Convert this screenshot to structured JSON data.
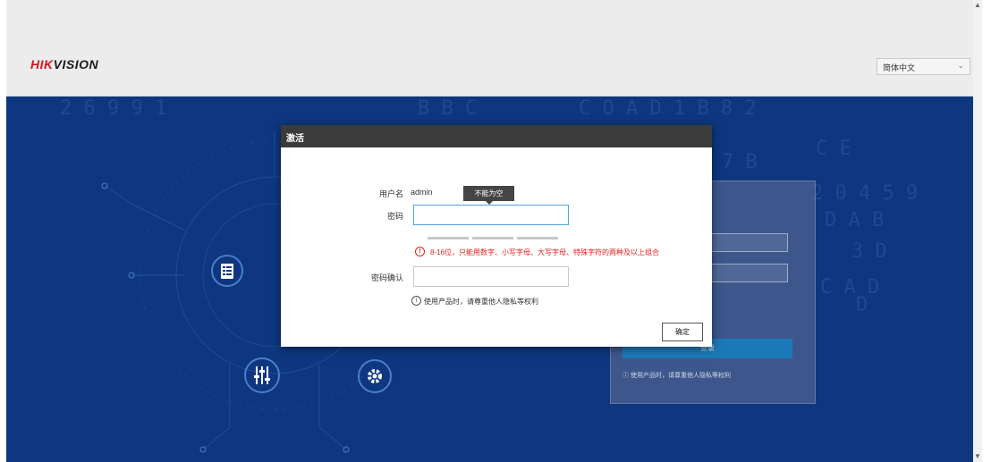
{
  "header": {
    "logo_brand": "HIK",
    "logo_rest": "VISION",
    "language": {
      "selected": "简体中文"
    }
  },
  "icons": {
    "clipboard": "list-icon",
    "sliders": "equalizer-icon",
    "settings": "gear-icon"
  },
  "background_login": {
    "login_button": "登录",
    "notice": "使用产品时，请尊重他人隐私等权利"
  },
  "dialog": {
    "title": "激活",
    "username_label": "用户名",
    "username_value": "admin",
    "password_label": "密码",
    "password_tooltip": "不能为空",
    "password_strength": {
      "segments": 3,
      "filled": 0
    },
    "password_rule": "8-16位，只能用数字、小写字母、大写字母、特殊字符的两种及以上组合",
    "confirm_label": "密码确认",
    "notice": "使用产品时，请尊重他人隐私等权利",
    "ok_button": "确定"
  },
  "colors": {
    "header_bg": "#ececec",
    "login_bg": "#0e3780",
    "error": "#e02020",
    "focus_border": "#4aa3df",
    "brand_red": "#d2161e",
    "login_button": "#1c79b7"
  }
}
